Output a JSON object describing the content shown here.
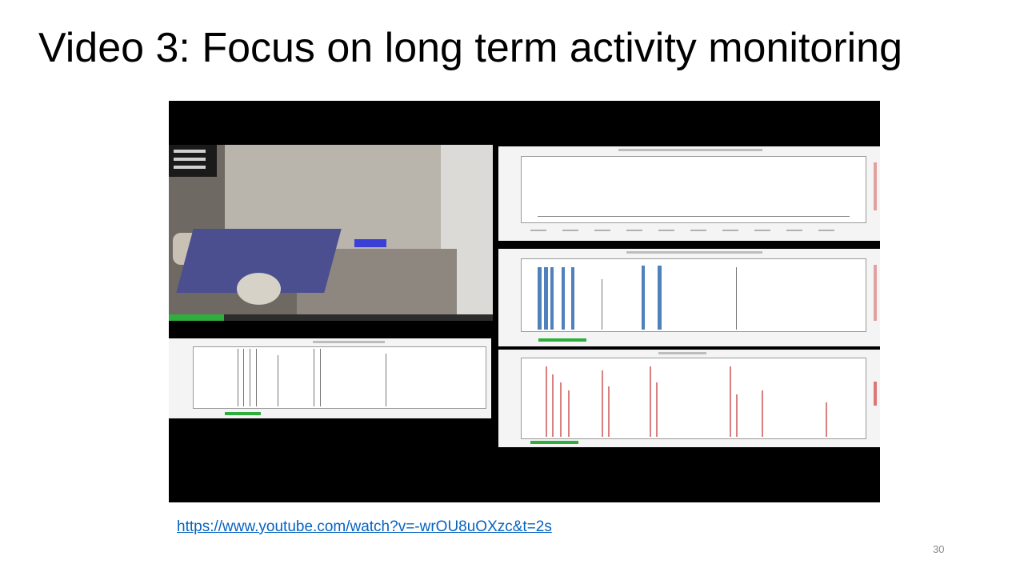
{
  "slide": {
    "title": "Video 3: Focus on long term activity monitoring",
    "link": "https://www.youtube.com/watch?v=-wrOU8uOXzc&t=2s",
    "page_number": "30"
  },
  "video": {
    "playback_progress": 0.17
  },
  "colors": {
    "link": "#0563c1",
    "bar": "#4f81bd",
    "progress": "#2fae3d",
    "spike": "#d98080"
  }
}
